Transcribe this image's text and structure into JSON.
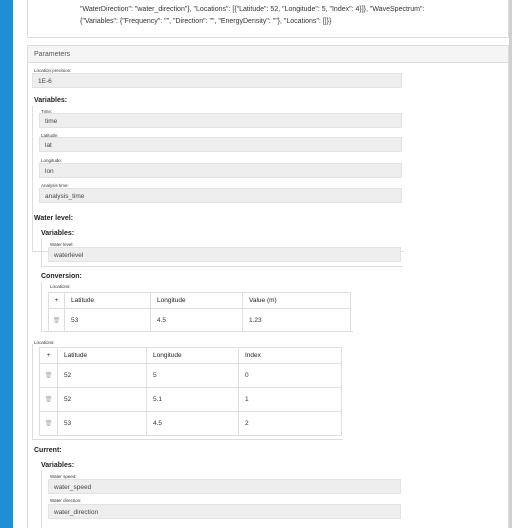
{
  "json_preview": {
    "line1": "\"WaterDirection\": \"water_direction\"}, \"Locations\": [{\"Latitude\": 52, \"Longitude\": 5, \"Index\": 4}]}, \"WaveSpectrum\":",
    "line2": "{\"Variables\": {\"Frequency\": \"\", \"Direction\": \"\", \"EnergyDensity\": \"\"}, \"Locations\": []}}"
  },
  "parameters": {
    "title": "Parameters",
    "location_precision": {
      "label": "Location precision:",
      "value": "1E-6"
    },
    "variables_title": "Variables:",
    "time": {
      "label": "Time:",
      "value": "time"
    },
    "latitude": {
      "label": "Latitude:",
      "value": "lat"
    },
    "longitude": {
      "label": "Longitude:",
      "value": "lon"
    },
    "analysis_time": {
      "label": "Analysis time:",
      "value": "analysis_time"
    }
  },
  "water_level": {
    "title": "Water level:",
    "variables_title": "Variables:",
    "water_level_field": {
      "label": "Water level:",
      "value": "waterlevel"
    },
    "conversion_title": "Conversion:",
    "conversion_locations_label": "Locations:",
    "conversion_table": {
      "headers": [
        "Latitude",
        "Longitude",
        "Value (m)"
      ],
      "rows": [
        [
          "53",
          "4.5",
          "1.23"
        ]
      ]
    },
    "locations_label": "Locations:",
    "locations_table": {
      "headers": [
        "Latitude",
        "Longitude",
        "Index"
      ],
      "rows": [
        [
          "52",
          "5",
          "0"
        ],
        [
          "52",
          "5.1",
          "1"
        ],
        [
          "53",
          "4.5",
          "2"
        ]
      ]
    }
  },
  "current": {
    "title": "Current:",
    "variables_title": "Variables:",
    "water_speed": {
      "label": "Water speed:",
      "value": "water_speed"
    },
    "water_direction": {
      "label": "Water direction:",
      "value": "water_direction"
    }
  },
  "icons": {
    "add": "+",
    "delete": "trash-icon"
  },
  "colors": {
    "accent_bar": "#1e8fd6",
    "input_bg": "#eeeeee",
    "border": "#dddddd"
  }
}
